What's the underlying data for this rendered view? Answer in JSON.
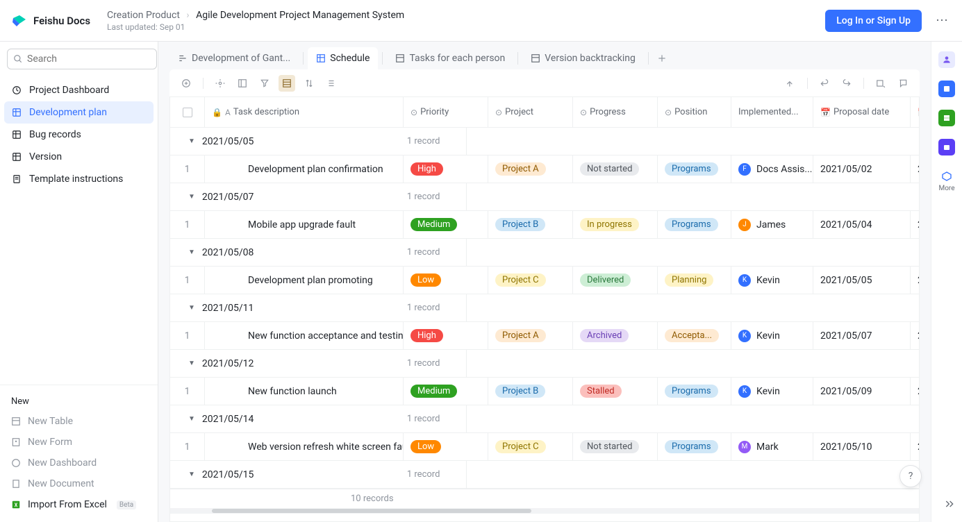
{
  "app": {
    "name": "Feishu Docs"
  },
  "breadcrumb": {
    "parent": "Creation Product",
    "current": "Agile Development Project Management System",
    "updated": "Last updated: Sep 01"
  },
  "header": {
    "login": "Log In or Sign Up"
  },
  "search": {
    "placeholder": "Search"
  },
  "sidebar": {
    "items": [
      {
        "label": "Project Dashboard"
      },
      {
        "label": "Development plan"
      },
      {
        "label": "Bug records"
      },
      {
        "label": "Version"
      },
      {
        "label": "Template instructions"
      }
    ],
    "new_label": "New",
    "new_items": [
      {
        "label": "New Table"
      },
      {
        "label": "New Form"
      },
      {
        "label": "New Dashboard"
      },
      {
        "label": "New Document"
      }
    ],
    "import": {
      "label": "Import From Excel",
      "badge": "Beta"
    }
  },
  "tabs": [
    {
      "label": "Development of Gant..."
    },
    {
      "label": "Schedule"
    },
    {
      "label": "Tasks for each person"
    },
    {
      "label": "Version backtracking"
    }
  ],
  "columns": {
    "task": "Task description",
    "priority": "Priority",
    "project": "Project",
    "progress": "Progress",
    "position": "Position",
    "implemented": "Implemented...",
    "proposal": "Proposal date"
  },
  "groups": [
    {
      "date": "2021/05/05",
      "count": "1 record",
      "rows": [
        {
          "idx": "1",
          "task": "Development plan confirmation",
          "priority": "High",
          "priority_cls": "p-high",
          "project": "Project A",
          "project_cls": "proj-a",
          "progress": "Not started",
          "progress_cls": "prog-notstarted",
          "position": "Programs",
          "position_cls": "pos-programs",
          "impl": "Docs Assis...",
          "impl_av": "F",
          "impl_av_cls": "av-blue",
          "date": "2021/05/02",
          "end": "2"
        }
      ]
    },
    {
      "date": "2021/05/07",
      "count": "1 record",
      "rows": [
        {
          "idx": "1",
          "task": "Mobile app upgrade fault",
          "priority": "Medium",
          "priority_cls": "p-medium",
          "project": "Project B",
          "project_cls": "proj-b",
          "progress": "In progress",
          "progress_cls": "prog-inprogress",
          "position": "Programs",
          "position_cls": "pos-programs",
          "impl": "James",
          "impl_av": "J",
          "impl_av_cls": "av-orange",
          "date": "2021/05/04",
          "end": "2"
        }
      ]
    },
    {
      "date": "2021/05/08",
      "count": "1 record",
      "rows": [
        {
          "idx": "1",
          "task": "Development plan promoting",
          "priority": "Low",
          "priority_cls": "p-low",
          "project": "Project C",
          "project_cls": "proj-c",
          "progress": "Delivered",
          "progress_cls": "prog-delivered",
          "position": "Planning",
          "position_cls": "pos-planning",
          "impl": "Kevin",
          "impl_av": "K",
          "impl_av_cls": "av-blue",
          "date": "2021/05/05",
          "end": "2"
        }
      ]
    },
    {
      "date": "2021/05/11",
      "count": "1 record",
      "rows": [
        {
          "idx": "1",
          "task": "New function acceptance and testing",
          "priority": "High",
          "priority_cls": "p-high",
          "project": "Project A",
          "project_cls": "proj-a",
          "progress": "Archived",
          "progress_cls": "prog-archived",
          "position": "Accepta...",
          "position_cls": "pos-acceptance",
          "impl": "Kevin",
          "impl_av": "K",
          "impl_av_cls": "av-blue",
          "date": "2021/05/07",
          "end": "2"
        }
      ]
    },
    {
      "date": "2021/05/12",
      "count": "1 record",
      "rows": [
        {
          "idx": "1",
          "task": "New function launch",
          "priority": "Medium",
          "priority_cls": "p-medium",
          "project": "Project B",
          "project_cls": "proj-b",
          "progress": "Stalled",
          "progress_cls": "prog-stalled",
          "position": "Programs",
          "position_cls": "pos-programs",
          "impl": "Kevin",
          "impl_av": "K",
          "impl_av_cls": "av-blue",
          "date": "2021/05/09",
          "end": "2"
        }
      ]
    },
    {
      "date": "2021/05/14",
      "count": "1 record",
      "rows": [
        {
          "idx": "1",
          "task": "Web version refresh white screen fault",
          "priority": "Low",
          "priority_cls": "p-low",
          "project": "Project C",
          "project_cls": "proj-c",
          "progress": "Not started",
          "progress_cls": "prog-notstarted",
          "position": "Programs",
          "position_cls": "pos-programs",
          "impl": "Mark",
          "impl_av": "M",
          "impl_av_cls": "av-purple",
          "date": "2021/05/10",
          "end": "2"
        }
      ]
    },
    {
      "date": "2021/05/15",
      "count": "1 record",
      "rows": []
    }
  ],
  "footer": {
    "total": "10 records"
  },
  "rail": {
    "more": "More"
  }
}
